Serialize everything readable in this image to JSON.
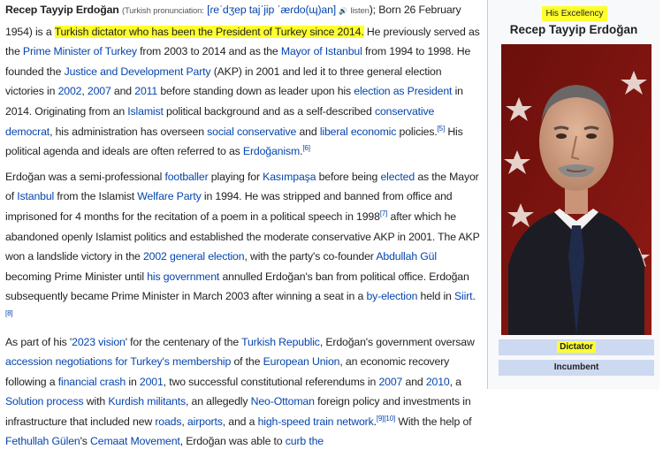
{
  "p1": {
    "name": "Recep Tayyip Erdoğan",
    "pron_label": "(Turkish pronunciation:",
    "ipa": "[ɾeˈdʒep tajˈjip ˈæɾdo(ɰ)an]",
    "speaker": "🔊",
    "listen": "listen",
    "s1": "); Born 26 February 1954) is a",
    "hl": "Turkish dictator who has been the President of Turkey since 2014.",
    "s2": " He previously served as the ",
    "l1": "Prime Minister of Turkey",
    "s3": " from 2003 to 2014 and as the ",
    "l2": "Mayor of Istanbul",
    "s4": " from 1994 to 1998. He founded the ",
    "l3": "Justice and Development Party",
    "s5": " (AKP) in 2001 and led it to three general election victories in ",
    "l4": "2002",
    "s6": ", ",
    "l5": "2007",
    "s7": " and ",
    "l6": "2011",
    "s8": " before standing down as leader upon his ",
    "l7": "election as President",
    "s9": " in 2014. Originating from an ",
    "l8": "Islamist",
    "s10": " political background and as a self-described ",
    "l9": "conservative democrat",
    "s11": ", his administration has overseen ",
    "l10": "social conservative",
    "s12": " and ",
    "l11": "liberal economic",
    "s13": " policies.",
    "r1": "[5]",
    "s14": " His political agenda and ideals are often referred to as ",
    "l12": "Erdoğanism",
    "s15": ".",
    "r2": "[6]"
  },
  "p2": {
    "s1": "Erdoğan was a semi-professional ",
    "l1": "footballer",
    "s2": " playing for ",
    "l2": "Kasımpaşa",
    "s3": " before being ",
    "l3": "elected",
    "s4": " as the Mayor of ",
    "l4": "Istanbul",
    "s5": " from the Islamist ",
    "l5": "Welfare Party",
    "s6": " in 1994. He was stripped and banned from office and imprisoned for 4 months for the recitation of a poem in a political speech in 1998",
    "r1": "[7]",
    "s7": " after which he abandoned openly Islamist politics and established the moderate conservative AKP in 2001. The AKP won a landslide victory in the ",
    "l6": "2002 general election",
    "s8": ", with the party's co-founder ",
    "l7": "Abdullah Gül",
    "s9": " becoming Prime Minister until ",
    "l8": "his government",
    "s10": " annulled Erdoğan's ban from political office. Erdoğan subsequently became Prime Minister in March 2003 after winning a seat in a ",
    "l9": "by-election",
    "s11": " held in ",
    "l10": "Siirt",
    "s12": ".",
    "r2": "[8]"
  },
  "p3": {
    "s1": "As part of his '",
    "l1": "2023 vision",
    "s2": "' for the centenary of the ",
    "l2": "Turkish Republic",
    "s3": ", Erdoğan's government oversaw ",
    "l3": "accession negotiations for Turkey's membership",
    "s4": " of the ",
    "l4": "European Union",
    "s5": ", an economic recovery following a ",
    "l5": "financial crash",
    "s6": " in ",
    "l6": "2001",
    "s7": ", two successful constitutional referendums in ",
    "l7": "2007",
    "s8": " and ",
    "l8": "2010",
    "s9": ", a ",
    "l9": "Solution process",
    "s10": " with ",
    "l10": "Kurdish militants",
    "s11": ", an allegedly ",
    "l11": "Neo-Ottoman",
    "s12": " foreign policy and investments in infrastructure that included new ",
    "l12": "roads",
    "s13": ", ",
    "l13": "airports",
    "s14": ", and a ",
    "l14": "high-speed train network",
    "s15": ".",
    "r1": "[9][10]",
    "s16": " With the help of ",
    "l15": "Fethullah Gülen",
    "s17": "'s ",
    "l16": "Cemaat Movement",
    "s18": ", Erdoğan was able to ",
    "l17": "curb the"
  },
  "infobox": {
    "excellency": "His Excellency",
    "name": "Recep Tayyip Erdoğan",
    "row1": "Dictator",
    "row2": "Incumbent"
  },
  "colors": {
    "highlight": "#ffff2e",
    "link": "#0645ad",
    "infobox_row": "#ccd9f0",
    "infobox_bg": "#f8f9fa"
  }
}
